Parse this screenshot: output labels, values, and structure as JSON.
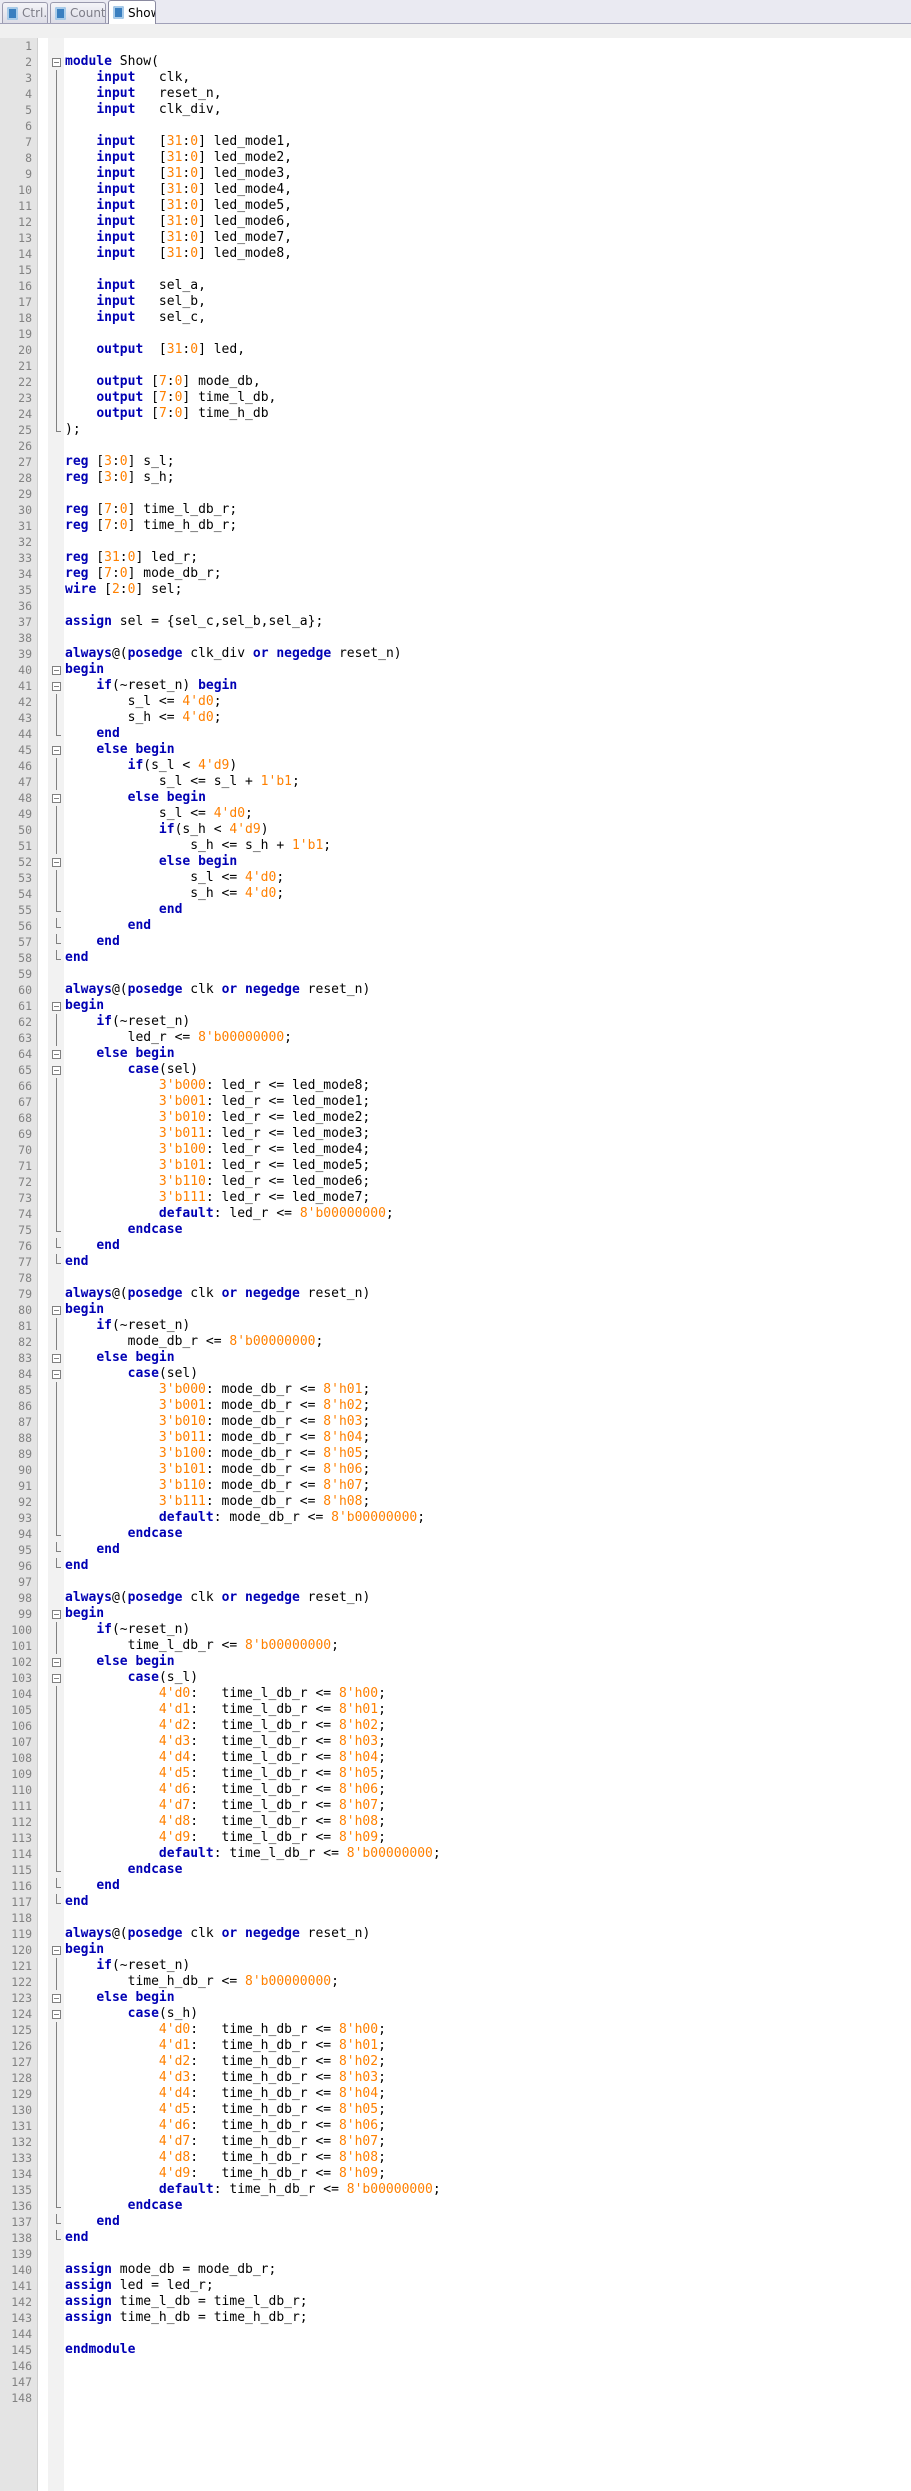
{
  "tabs": [
    {
      "label": "Ctrl.v",
      "active": false
    },
    {
      "label": "Counter.v",
      "active": false
    },
    {
      "label": "Show.v",
      "active": true
    }
  ],
  "colors": {
    "keyword": "#0000b4",
    "number": "#ff8000",
    "text": "#000000",
    "line_number": "#828282"
  },
  "editor": {
    "language": "verilog",
    "keywords": [
      "module",
      "input",
      "output",
      "reg",
      "wire",
      "assign",
      "always",
      "posedge",
      "negedge",
      "or",
      "begin",
      "end",
      "if",
      "else",
      "case",
      "endcase",
      "default",
      "endmodule"
    ],
    "fold_markers": {
      "2": "box",
      "3": "vline",
      "4": "vline",
      "5": "vline",
      "6": "vline",
      "7": "vline",
      "8": "vline",
      "9": "vline",
      "10": "vline",
      "11": "vline",
      "12": "vline",
      "13": "vline",
      "14": "vline",
      "15": "vline",
      "16": "vline",
      "17": "vline",
      "18": "vline",
      "19": "vline",
      "20": "vline",
      "21": "vline",
      "22": "vline",
      "23": "vline",
      "24": "vline",
      "25": "end",
      "40": "box",
      "41": "box",
      "42": "vline",
      "43": "vline",
      "44": "end",
      "45": "box",
      "46": "vline",
      "47": "vline",
      "48": "box",
      "49": "vline",
      "50": "vline",
      "51": "vline",
      "52": "box",
      "53": "vline",
      "54": "vline",
      "55": "end",
      "56": "end",
      "57": "end",
      "58": "end",
      "61": "box",
      "62": "vline",
      "63": "vline",
      "64": "box",
      "65": "box",
      "66": "vline",
      "67": "vline",
      "68": "vline",
      "69": "vline",
      "70": "vline",
      "71": "vline",
      "72": "vline",
      "73": "vline",
      "74": "vline",
      "75": "end",
      "76": "end",
      "77": "end",
      "80": "box",
      "81": "vline",
      "82": "vline",
      "83": "box",
      "84": "box",
      "85": "vline",
      "86": "vline",
      "87": "vline",
      "88": "vline",
      "89": "vline",
      "90": "vline",
      "91": "vline",
      "92": "vline",
      "93": "vline",
      "94": "end",
      "95": "end",
      "96": "end",
      "99": "box",
      "100": "vline",
      "101": "vline",
      "102": "box",
      "103": "box",
      "104": "vline",
      "105": "vline",
      "106": "vline",
      "107": "vline",
      "108": "vline",
      "109": "vline",
      "110": "vline",
      "111": "vline",
      "112": "vline",
      "113": "vline",
      "114": "vline",
      "115": "end",
      "116": "end",
      "117": "end",
      "120": "box",
      "121": "vline",
      "122": "vline",
      "123": "box",
      "124": "box",
      "125": "vline",
      "126": "vline",
      "127": "vline",
      "128": "vline",
      "129": "vline",
      "130": "vline",
      "131": "vline",
      "132": "vline",
      "133": "vline",
      "134": "vline",
      "135": "vline",
      "136": "end",
      "137": "end",
      "138": "end"
    },
    "lines": [
      {
        "n": "1",
        "text": ""
      },
      {
        "n": "2",
        "text": "module Show("
      },
      {
        "n": "3",
        "text": "    input   clk,"
      },
      {
        "n": "4",
        "text": "    input   reset_n,"
      },
      {
        "n": "5",
        "text": "    input   clk_div,"
      },
      {
        "n": "6",
        "text": ""
      },
      {
        "n": "7",
        "text": "    input   [31:0] led_mode1,"
      },
      {
        "n": "8",
        "text": "    input   [31:0] led_mode2,"
      },
      {
        "n": "9",
        "text": "    input   [31:0] led_mode3,"
      },
      {
        "n": "10",
        "text": "    input   [31:0] led_mode4,"
      },
      {
        "n": "11",
        "text": "    input   [31:0] led_mode5,"
      },
      {
        "n": "12",
        "text": "    input   [31:0] led_mode6,"
      },
      {
        "n": "13",
        "text": "    input   [31:0] led_mode7,"
      },
      {
        "n": "14",
        "text": "    input   [31:0] led_mode8,"
      },
      {
        "n": "15",
        "text": ""
      },
      {
        "n": "16",
        "text": "    input   sel_a,"
      },
      {
        "n": "17",
        "text": "    input   sel_b,"
      },
      {
        "n": "18",
        "text": "    input   sel_c,"
      },
      {
        "n": "19",
        "text": ""
      },
      {
        "n": "20",
        "text": "    output  [31:0] led,"
      },
      {
        "n": "21",
        "text": ""
      },
      {
        "n": "22",
        "text": "    output [7:0] mode_db,"
      },
      {
        "n": "23",
        "text": "    output [7:0] time_l_db,"
      },
      {
        "n": "24",
        "text": "    output [7:0] time_h_db"
      },
      {
        "n": "25",
        "text": ");"
      },
      {
        "n": "26",
        "text": ""
      },
      {
        "n": "27",
        "text": "reg [3:0] s_l;"
      },
      {
        "n": "28",
        "text": "reg [3:0] s_h;"
      },
      {
        "n": "29",
        "text": ""
      },
      {
        "n": "30",
        "text": "reg [7:0] time_l_db_r;"
      },
      {
        "n": "31",
        "text": "reg [7:0] time_h_db_r;"
      },
      {
        "n": "32",
        "text": ""
      },
      {
        "n": "33",
        "text": "reg [31:0] led_r;"
      },
      {
        "n": "34",
        "text": "reg [7:0] mode_db_r;"
      },
      {
        "n": "35",
        "text": "wire [2:0] sel;"
      },
      {
        "n": "36",
        "text": ""
      },
      {
        "n": "37",
        "text": "assign sel = {sel_c,sel_b,sel_a};"
      },
      {
        "n": "38",
        "text": ""
      },
      {
        "n": "39",
        "text": "always@(posedge clk_div or negedge reset_n)"
      },
      {
        "n": "40",
        "text": "begin"
      },
      {
        "n": "41",
        "text": "    if(~reset_n) begin"
      },
      {
        "n": "42",
        "text": "        s_l <= 4'd0;"
      },
      {
        "n": "43",
        "text": "        s_h <= 4'd0;"
      },
      {
        "n": "44",
        "text": "    end"
      },
      {
        "n": "45",
        "text": "    else begin"
      },
      {
        "n": "46",
        "text": "        if(s_l < 4'd9)"
      },
      {
        "n": "47",
        "text": "            s_l <= s_l + 1'b1;"
      },
      {
        "n": "48",
        "text": "        else begin"
      },
      {
        "n": "49",
        "text": "            s_l <= 4'd0;"
      },
      {
        "n": "50",
        "text": "            if(s_h < 4'd9)"
      },
      {
        "n": "51",
        "text": "                s_h <= s_h + 1'b1;"
      },
      {
        "n": "52",
        "text": "            else begin"
      },
      {
        "n": "53",
        "text": "                s_l <= 4'd0;"
      },
      {
        "n": "54",
        "text": "                s_h <= 4'd0;"
      },
      {
        "n": "55",
        "text": "            end"
      },
      {
        "n": "56",
        "text": "        end"
      },
      {
        "n": "57",
        "text": "    end"
      },
      {
        "n": "58",
        "text": "end"
      },
      {
        "n": "59",
        "text": ""
      },
      {
        "n": "60",
        "text": "always@(posedge clk or negedge reset_n)"
      },
      {
        "n": "61",
        "text": "begin"
      },
      {
        "n": "62",
        "text": "    if(~reset_n)"
      },
      {
        "n": "63",
        "text": "        led_r <= 8'b00000000;"
      },
      {
        "n": "64",
        "text": "    else begin"
      },
      {
        "n": "65",
        "text": "        case(sel)"
      },
      {
        "n": "66",
        "text": "            3'b000: led_r <= led_mode8;"
      },
      {
        "n": "67",
        "text": "            3'b001: led_r <= led_mode1;"
      },
      {
        "n": "68",
        "text": "            3'b010: led_r <= led_mode2;"
      },
      {
        "n": "69",
        "text": "            3'b011: led_r <= led_mode3;"
      },
      {
        "n": "70",
        "text": "            3'b100: led_r <= led_mode4;"
      },
      {
        "n": "71",
        "text": "            3'b101: led_r <= led_mode5;"
      },
      {
        "n": "72",
        "text": "            3'b110: led_r <= led_mode6;"
      },
      {
        "n": "73",
        "text": "            3'b111: led_r <= led_mode7;"
      },
      {
        "n": "74",
        "text": "            default: led_r <= 8'b00000000;"
      },
      {
        "n": "75",
        "text": "        endcase"
      },
      {
        "n": "76",
        "text": "    end"
      },
      {
        "n": "77",
        "text": "end"
      },
      {
        "n": "78",
        "text": ""
      },
      {
        "n": "79",
        "text": "always@(posedge clk or negedge reset_n)"
      },
      {
        "n": "80",
        "text": "begin"
      },
      {
        "n": "81",
        "text": "    if(~reset_n)"
      },
      {
        "n": "82",
        "text": "        mode_db_r <= 8'b00000000;"
      },
      {
        "n": "83",
        "text": "    else begin"
      },
      {
        "n": "84",
        "text": "        case(sel)"
      },
      {
        "n": "85",
        "text": "            3'b000: mode_db_r <= 8'h01;"
      },
      {
        "n": "86",
        "text": "            3'b001: mode_db_r <= 8'h02;"
      },
      {
        "n": "87",
        "text": "            3'b010: mode_db_r <= 8'h03;"
      },
      {
        "n": "88",
        "text": "            3'b011: mode_db_r <= 8'h04;"
      },
      {
        "n": "89",
        "text": "            3'b100: mode_db_r <= 8'h05;"
      },
      {
        "n": "90",
        "text": "            3'b101: mode_db_r <= 8'h06;"
      },
      {
        "n": "91",
        "text": "            3'b110: mode_db_r <= 8'h07;"
      },
      {
        "n": "92",
        "text": "            3'b111: mode_db_r <= 8'h08;"
      },
      {
        "n": "93",
        "text": "            default: mode_db_r <= 8'b00000000;"
      },
      {
        "n": "94",
        "text": "        endcase"
      },
      {
        "n": "95",
        "text": "    end"
      },
      {
        "n": "96",
        "text": "end"
      },
      {
        "n": "97",
        "text": ""
      },
      {
        "n": "98",
        "text": "always@(posedge clk or negedge reset_n)"
      },
      {
        "n": "99",
        "text": "begin"
      },
      {
        "n": "100",
        "text": "    if(~reset_n)"
      },
      {
        "n": "101",
        "text": "        time_l_db_r <= 8'b00000000;"
      },
      {
        "n": "102",
        "text": "    else begin"
      },
      {
        "n": "103",
        "text": "        case(s_l)"
      },
      {
        "n": "104",
        "text": "            4'd0:   time_l_db_r <= 8'h00;"
      },
      {
        "n": "105",
        "text": "            4'd1:   time_l_db_r <= 8'h01;"
      },
      {
        "n": "106",
        "text": "            4'd2:   time_l_db_r <= 8'h02;"
      },
      {
        "n": "107",
        "text": "            4'd3:   time_l_db_r <= 8'h03;"
      },
      {
        "n": "108",
        "text": "            4'd4:   time_l_db_r <= 8'h04;"
      },
      {
        "n": "109",
        "text": "            4'd5:   time_l_db_r <= 8'h05;"
      },
      {
        "n": "110",
        "text": "            4'd6:   time_l_db_r <= 8'h06;"
      },
      {
        "n": "111",
        "text": "            4'd7:   time_l_db_r <= 8'h07;"
      },
      {
        "n": "112",
        "text": "            4'd8:   time_l_db_r <= 8'h08;"
      },
      {
        "n": "113",
        "text": "            4'd9:   time_l_db_r <= 8'h09;"
      },
      {
        "n": "114",
        "text": "            default: time_l_db_r <= 8'b00000000;"
      },
      {
        "n": "115",
        "text": "        endcase"
      },
      {
        "n": "116",
        "text": "    end"
      },
      {
        "n": "117",
        "text": "end"
      },
      {
        "n": "118",
        "text": ""
      },
      {
        "n": "119",
        "text": "always@(posedge clk or negedge reset_n)"
      },
      {
        "n": "120",
        "text": "begin"
      },
      {
        "n": "121",
        "text": "    if(~reset_n)"
      },
      {
        "n": "122",
        "text": "        time_h_db_r <= 8'b00000000;"
      },
      {
        "n": "123",
        "text": "    else begin"
      },
      {
        "n": "124",
        "text": "        case(s_h)"
      },
      {
        "n": "125",
        "text": "            4'd0:   time_h_db_r <= 8'h00;"
      },
      {
        "n": "126",
        "text": "            4'd1:   time_h_db_r <= 8'h01;"
      },
      {
        "n": "127",
        "text": "            4'd2:   time_h_db_r <= 8'h02;"
      },
      {
        "n": "128",
        "text": "            4'd3:   time_h_db_r <= 8'h03;"
      },
      {
        "n": "129",
        "text": "            4'd4:   time_h_db_r <= 8'h04;"
      },
      {
        "n": "130",
        "text": "            4'd5:   time_h_db_r <= 8'h05;"
      },
      {
        "n": "131",
        "text": "            4'd6:   time_h_db_r <= 8'h06;"
      },
      {
        "n": "132",
        "text": "            4'd7:   time_h_db_r <= 8'h07;"
      },
      {
        "n": "133",
        "text": "            4'd8:   time_h_db_r <= 8'h08;"
      },
      {
        "n": "134",
        "text": "            4'd9:   time_h_db_r <= 8'h09;"
      },
      {
        "n": "135",
        "text": "            default: time_h_db_r <= 8'b00000000;"
      },
      {
        "n": "136",
        "text": "        endcase"
      },
      {
        "n": "137",
        "text": "    end"
      },
      {
        "n": "138",
        "text": "end"
      },
      {
        "n": "139",
        "text": ""
      },
      {
        "n": "140",
        "text": "assign mode_db = mode_db_r;"
      },
      {
        "n": "141",
        "text": "assign led = led_r;"
      },
      {
        "n": "142",
        "text": "assign time_l_db = time_l_db_r;"
      },
      {
        "n": "143",
        "text": "assign time_h_db = time_h_db_r;"
      },
      {
        "n": "144",
        "text": ""
      },
      {
        "n": "145",
        "text": "endmodule"
      },
      {
        "n": "146",
        "text": ""
      },
      {
        "n": "147",
        "text": ""
      },
      {
        "n": "148",
        "text": ""
      }
    ]
  }
}
